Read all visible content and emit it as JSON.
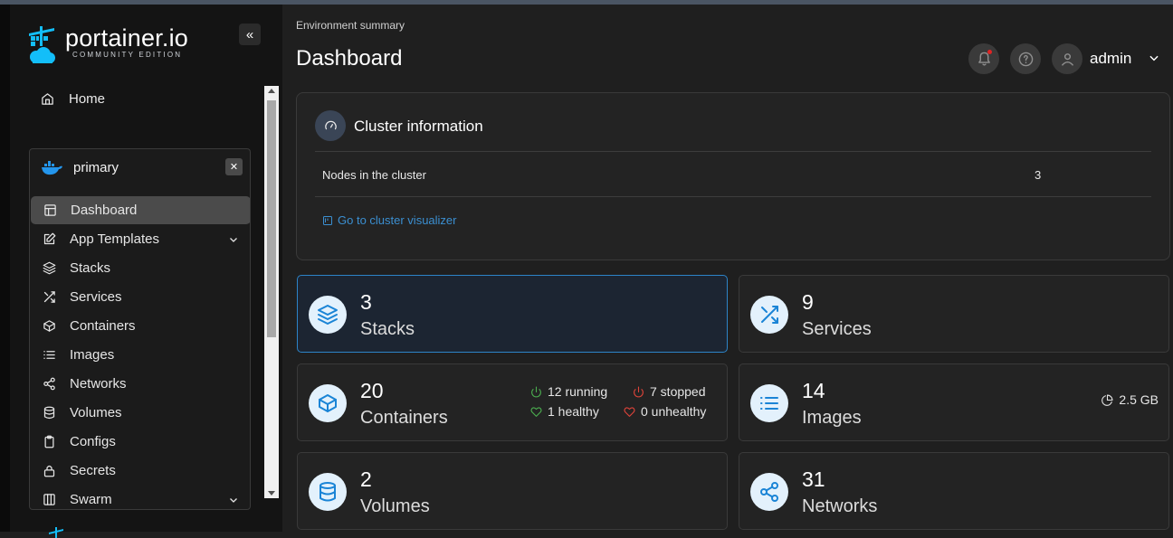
{
  "brand": {
    "name": "portainer.io",
    "edition": "COMMUNITY EDITION",
    "accent": "#1a84d6"
  },
  "sidebar": {
    "collapse_icon": "chevrons-left-icon",
    "home_label": "Home",
    "environment": {
      "name": "primary",
      "icon": "docker-whale-icon"
    },
    "items": [
      {
        "label": "Dashboard",
        "icon": "layout-icon",
        "active": true
      },
      {
        "label": "App Templates",
        "icon": "edit-icon",
        "expandable": true
      },
      {
        "label": "Stacks",
        "icon": "layers-icon"
      },
      {
        "label": "Services",
        "icon": "shuffle-icon"
      },
      {
        "label": "Containers",
        "icon": "box-icon"
      },
      {
        "label": "Images",
        "icon": "list-icon"
      },
      {
        "label": "Networks",
        "icon": "share-icon"
      },
      {
        "label": "Volumes",
        "icon": "database-icon"
      },
      {
        "label": "Configs",
        "icon": "clipboard-icon"
      },
      {
        "label": "Secrets",
        "icon": "lock-icon"
      },
      {
        "label": "Swarm",
        "icon": "grid-icon",
        "expandable": true
      }
    ]
  },
  "header": {
    "breadcrumb": "Environment summary",
    "title": "Dashboard",
    "user": "admin"
  },
  "cluster": {
    "title": "Cluster information",
    "nodes_label": "Nodes in the cluster",
    "nodes_value": "3",
    "visualizer_link": "Go to cluster visualizer"
  },
  "stats": {
    "stacks": {
      "count": "3",
      "label": "Stacks"
    },
    "services": {
      "count": "9",
      "label": "Services"
    },
    "containers": {
      "count": "20",
      "label": "Containers",
      "running": "12 running",
      "stopped": "7 stopped",
      "healthy": "1 healthy",
      "unhealthy": "0 unhealthy"
    },
    "images": {
      "count": "14",
      "label": "Images",
      "size": "2.5 GB"
    },
    "volumes": {
      "count": "2",
      "label": "Volumes"
    },
    "networks": {
      "count": "31",
      "label": "Networks"
    }
  },
  "colors": {
    "running": "#4caf50",
    "stopped": "#e0443a",
    "selected_border": "#2d84c8"
  }
}
